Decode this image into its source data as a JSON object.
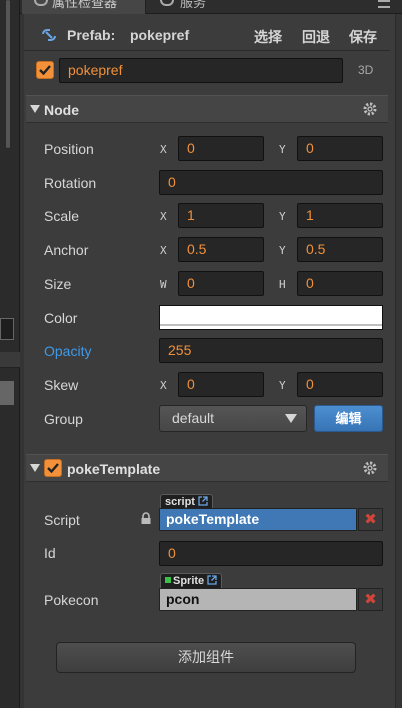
{
  "tabs": [
    {
      "label": "属性检查器",
      "icon": "gear-icon"
    },
    {
      "label": "服务",
      "icon": "cloud-icon"
    }
  ],
  "prefab_bar": {
    "label": "Prefab:",
    "name": "pokepref",
    "select": "选择",
    "revert": "回退",
    "save": "保存"
  },
  "node": {
    "name": "pokepref",
    "dimension": "3D",
    "section_title": "Node",
    "props": {
      "position": {
        "label": "Position",
        "x": "0",
        "y": "0"
      },
      "rotation": {
        "label": "Rotation",
        "value": "0"
      },
      "scale": {
        "label": "Scale",
        "x": "1",
        "y": "1"
      },
      "anchor": {
        "label": "Anchor",
        "x": "0.5",
        "y": "0.5"
      },
      "size": {
        "label": "Size",
        "w": "0",
        "h": "0"
      },
      "color": {
        "label": "Color",
        "value": "#ffffff"
      },
      "opacity": {
        "label": "Opacity",
        "value": "255"
      },
      "skew": {
        "label": "Skew",
        "x": "0",
        "y": "0"
      },
      "group": {
        "label": "Group",
        "value": "default",
        "edit": "编辑"
      }
    },
    "axis_labels": {
      "x": "X",
      "y": "Y",
      "w": "W",
      "h": "H"
    }
  },
  "component": {
    "title": "pokeTemplate",
    "script": {
      "label": "Script",
      "tag": "script",
      "value": "pokeTemplate"
    },
    "id": {
      "label": "Id",
      "value": "0"
    },
    "pokecon": {
      "label": "Pokecon",
      "tag": "Sprite",
      "value": "pcon"
    }
  },
  "add_component": "添加组件",
  "colors": {
    "accent": "#f2913a",
    "link_blue": "#3e9ae8",
    "panel": "#3c3c3c",
    "field_bg": "#262626",
    "remove_red": "#d0453a"
  }
}
